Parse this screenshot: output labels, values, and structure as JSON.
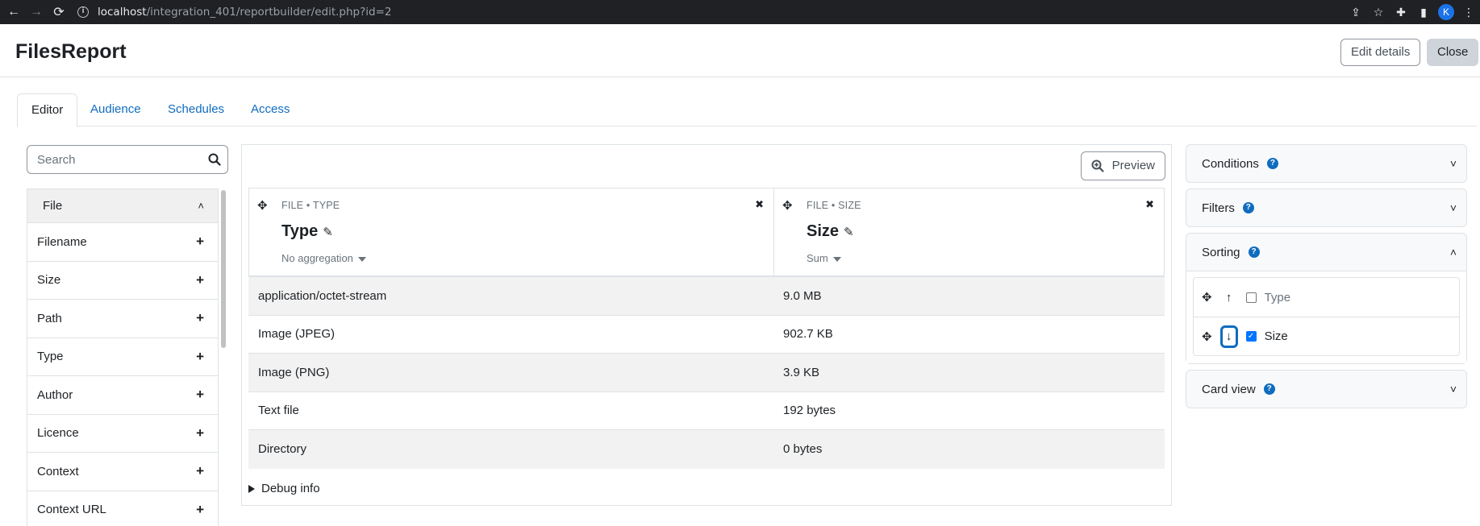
{
  "browser": {
    "url_host": "localhost",
    "url_path": "/integration_401/reportbuilder/edit.php?id=2",
    "profile_initial": "K"
  },
  "header": {
    "title": "FilesReport",
    "edit_details_label": "Edit details",
    "close_label": "Close"
  },
  "tabs": [
    "Editor",
    "Audience",
    "Schedules",
    "Access"
  ],
  "sidebar": {
    "search_placeholder": "Search",
    "section_label": "File",
    "items": [
      "Filename",
      "Size",
      "Path",
      "Type",
      "Author",
      "Licence",
      "Context",
      "Context URL"
    ]
  },
  "main": {
    "preview_label": "Preview",
    "columns": [
      {
        "kind": "FILE • TYPE",
        "name": "Type",
        "aggregation": "No aggregation"
      },
      {
        "kind": "FILE • SIZE",
        "name": "Size",
        "aggregation": "Sum"
      }
    ],
    "rows": [
      [
        "application/octet-stream",
        "9.0 MB"
      ],
      [
        "Image (JPEG)",
        "902.7 KB"
      ],
      [
        "Image (PNG)",
        "3.9 KB"
      ],
      [
        "Text file",
        "192 bytes"
      ],
      [
        "Directory",
        "0 bytes"
      ]
    ],
    "debug_label": "Debug info"
  },
  "panel": {
    "conditions_label": "Conditions",
    "filters_label": "Filters",
    "sorting_label": "Sorting",
    "sort_items": [
      {
        "label": "Type",
        "arrow": "↑",
        "checked": false
      },
      {
        "label": "Size",
        "arrow": "↓",
        "checked": true
      }
    ],
    "card_view_label": "Card view"
  }
}
